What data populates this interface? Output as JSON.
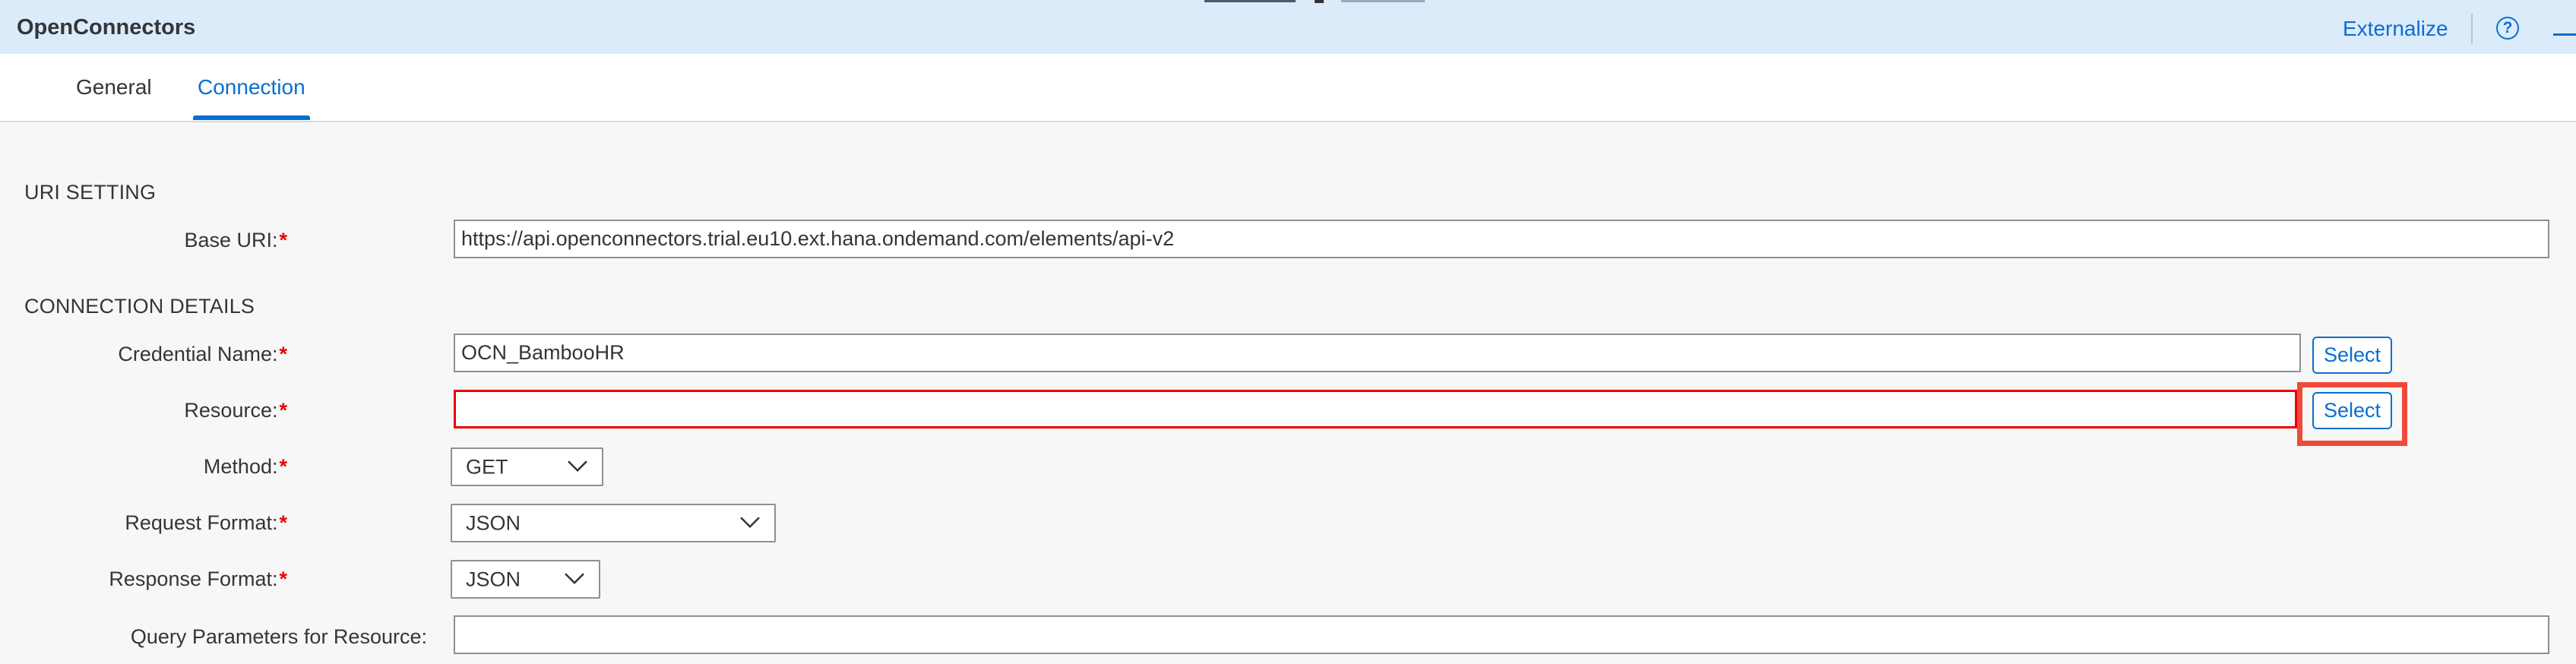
{
  "header": {
    "title": "OpenConnectors",
    "externalize_label": "Externalize",
    "help_glyph": "?"
  },
  "tabs": [
    {
      "label": "General",
      "active": false
    },
    {
      "label": "Connection",
      "active": true
    }
  ],
  "sections": {
    "uri_setting": "URI SETTING",
    "connection_details": "CONNECTION DETAILS"
  },
  "form": {
    "base_uri": {
      "label": "Base URI:",
      "value": "https://api.openconnectors.trial.eu10.ext.hana.ondemand.com/elements/api-v2",
      "required": true
    },
    "credential_name": {
      "label": "Credential Name:",
      "value": "OCN_BambooHR",
      "required": true,
      "button": "Select"
    },
    "resource": {
      "label": "Resource:",
      "value": "",
      "required": true,
      "button": "Select",
      "error": true
    },
    "method": {
      "label": "Method:",
      "value": "GET",
      "required": true
    },
    "request_format": {
      "label": "Request Format:",
      "value": "JSON",
      "required": true
    },
    "response_format": {
      "label": "Response Format:",
      "value": "JSON",
      "required": true
    },
    "query_parameters": {
      "label": "Query Parameters for Resource:",
      "value": "",
      "required": false
    }
  },
  "required_marker": "*",
  "colors": {
    "accent": "#0a6ed1",
    "header_bg": "#dcebf9",
    "error": "#e00000",
    "highlight": "#f0493a"
  }
}
